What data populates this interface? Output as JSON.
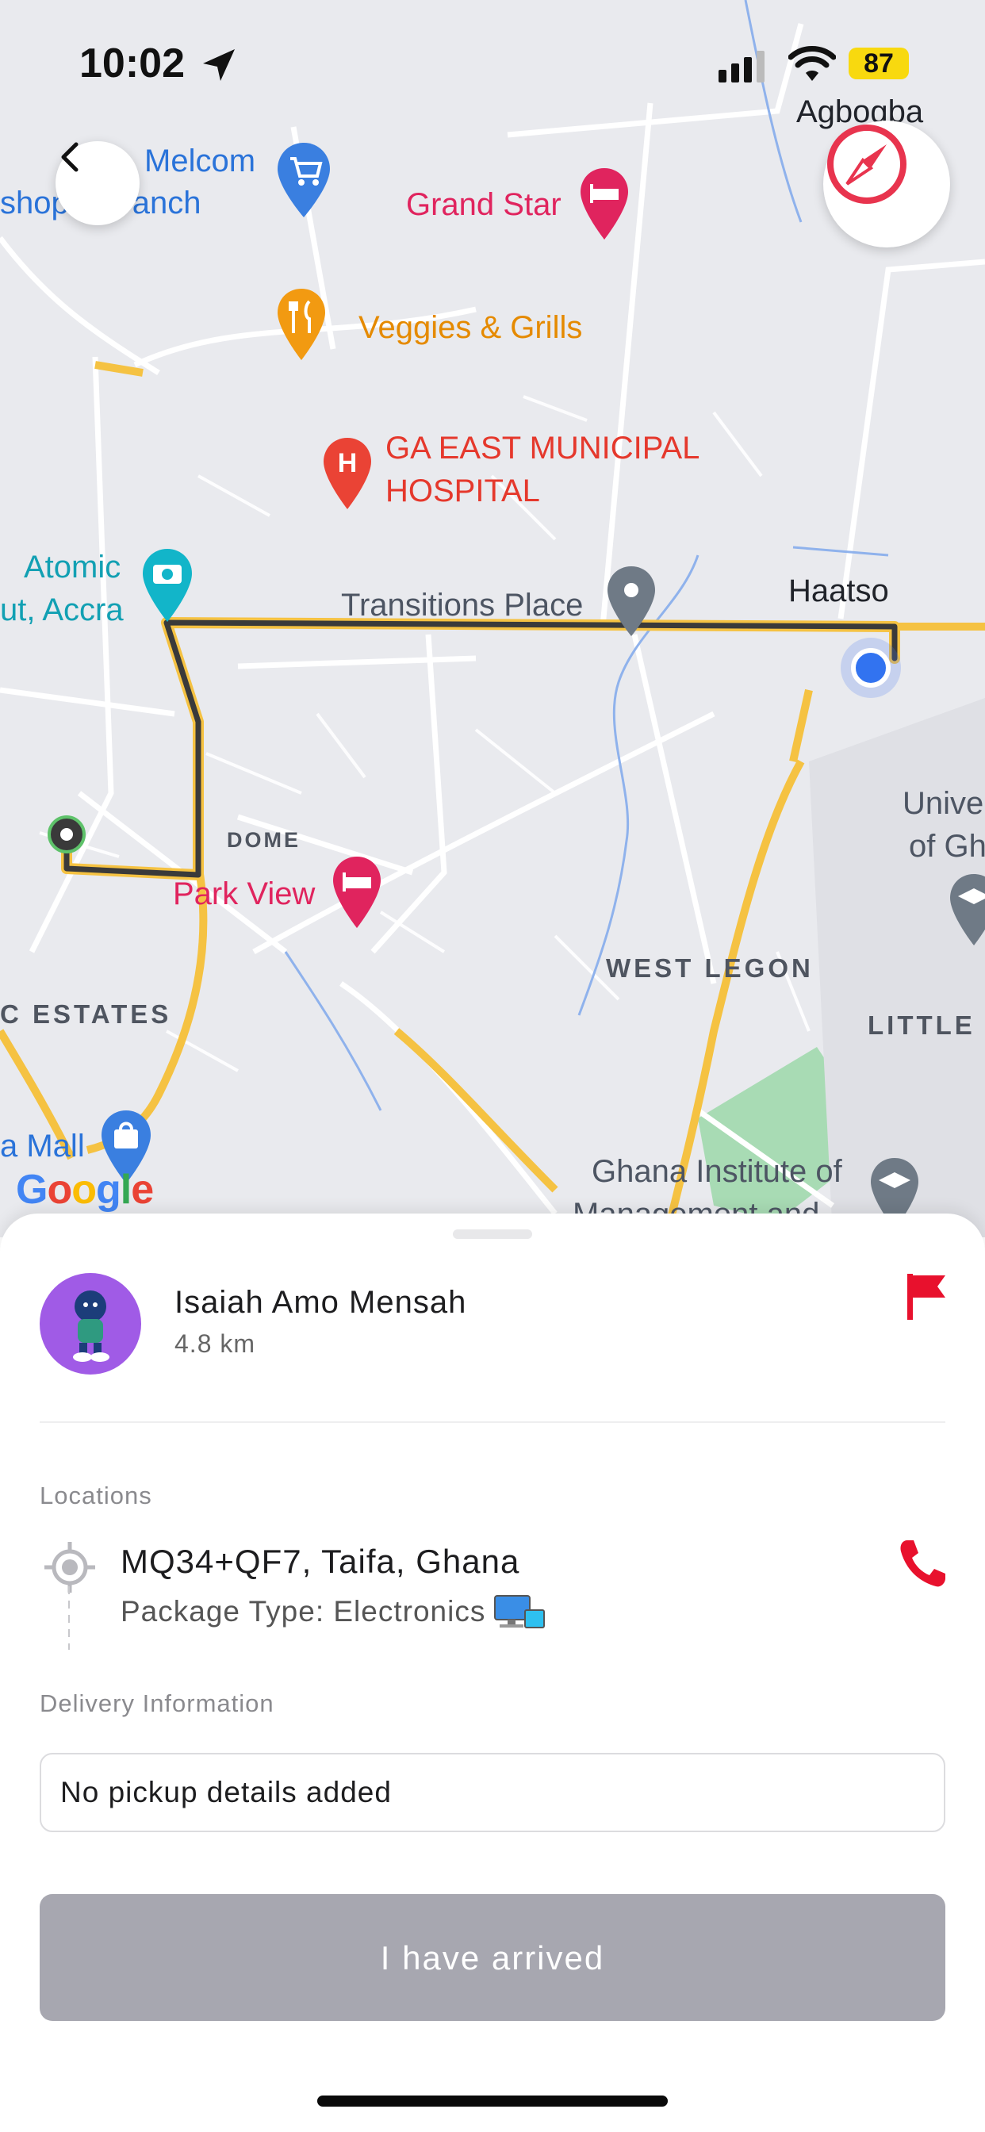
{
  "status_bar": {
    "time": "10:02",
    "battery": "87"
  },
  "map": {
    "pois": {
      "melcom": "Melcom",
      "melcom_branch": "shop    n branch",
      "grand_star": "Grand Star",
      "agbogba": "Agbogba",
      "veggies": "Veggies & Grills",
      "hospital_line1": "GA EAST MUNICIPAL",
      "hospital_line2": "HOSPITAL",
      "atomic_line1": "Atomic",
      "atomic_line2": "ut, Accra",
      "transitions": "Transitions Place",
      "haatso": "Haatso",
      "dome": "DOME",
      "park_view": "Park View",
      "univ_line1": "Unive",
      "univ_line2": "of Gh",
      "west_legon": "WEST LEGON",
      "little": "LITTLE",
      "c_estates": "C ESTATES",
      "a_mall": "a Mall",
      "ghana_inst_line1": "Ghana Institute of",
      "ghana_inst_line2": "Management and"
    },
    "attribution": "Google",
    "colors": {
      "route": "#3a3a3a",
      "main_road": "#f5c242",
      "water": "#8fb2ec",
      "park": "#a8dbb4"
    }
  },
  "sheet": {
    "driver": {
      "name": "Isaiah Amo Mensah",
      "distance": "4.8 km"
    },
    "locations_label": "Locations",
    "location": {
      "address": "MQ34+QF7, Taifa, Ghana",
      "package": "Package Type: Electronics"
    },
    "delivery_label": "Delivery Information",
    "pickup_details": "No pickup details added",
    "arrived_button": "I have arrived"
  },
  "icons": [
    "back-chevron-icon",
    "compass-icon",
    "flag-icon",
    "phone-icon",
    "location-target-icon",
    "computer-emoji-icon"
  ]
}
